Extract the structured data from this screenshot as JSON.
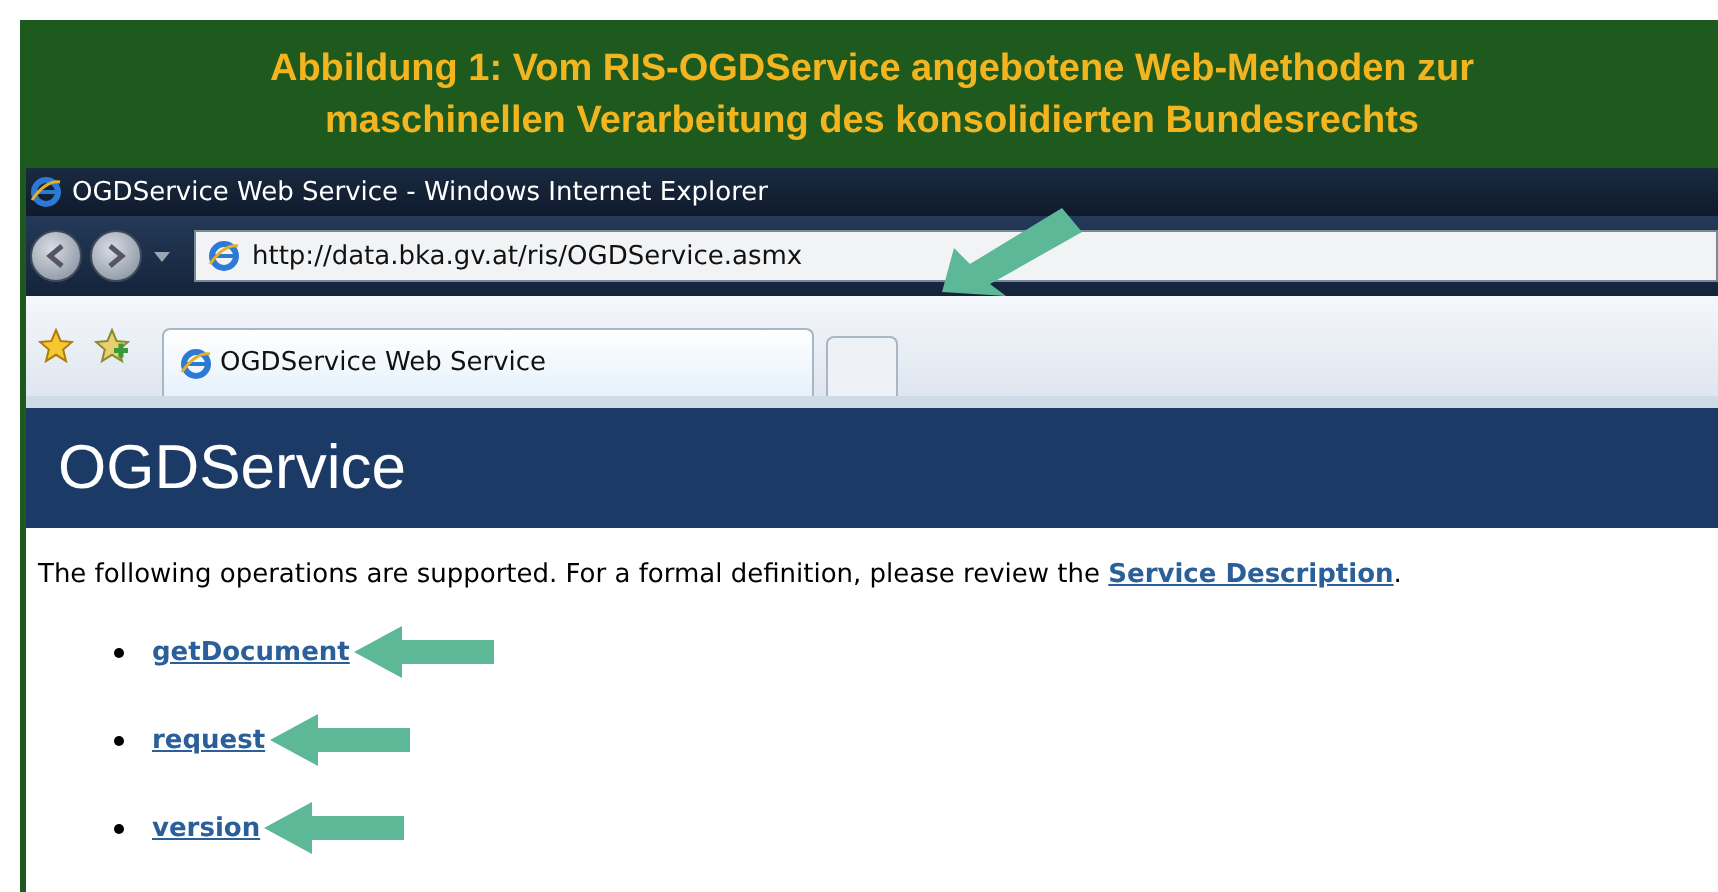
{
  "caption": {
    "lines": [
      "Abbildung 1: Vom RIS-OGDService angebotene Web-Methoden zur",
      "maschinellen Verarbeitung des konsolidierten Bundesrechts"
    ]
  },
  "window": {
    "title": "OGDService Web Service - Windows Internet Explorer"
  },
  "address_bar": {
    "value": "http://data.bka.gv.at/ris/OGDService.asmx"
  },
  "tabs": [
    {
      "label": "OGDService Web Service",
      "selected": true
    }
  ],
  "page": {
    "heading": "OGDService",
    "intro": {
      "text": "The following operations are supported. For a formal definition, please review the ",
      "link": "Service Description",
      "after": "."
    },
    "operations": [
      {
        "label": "getDocument"
      },
      {
        "label": "request"
      },
      {
        "label": "version"
      }
    ]
  }
}
